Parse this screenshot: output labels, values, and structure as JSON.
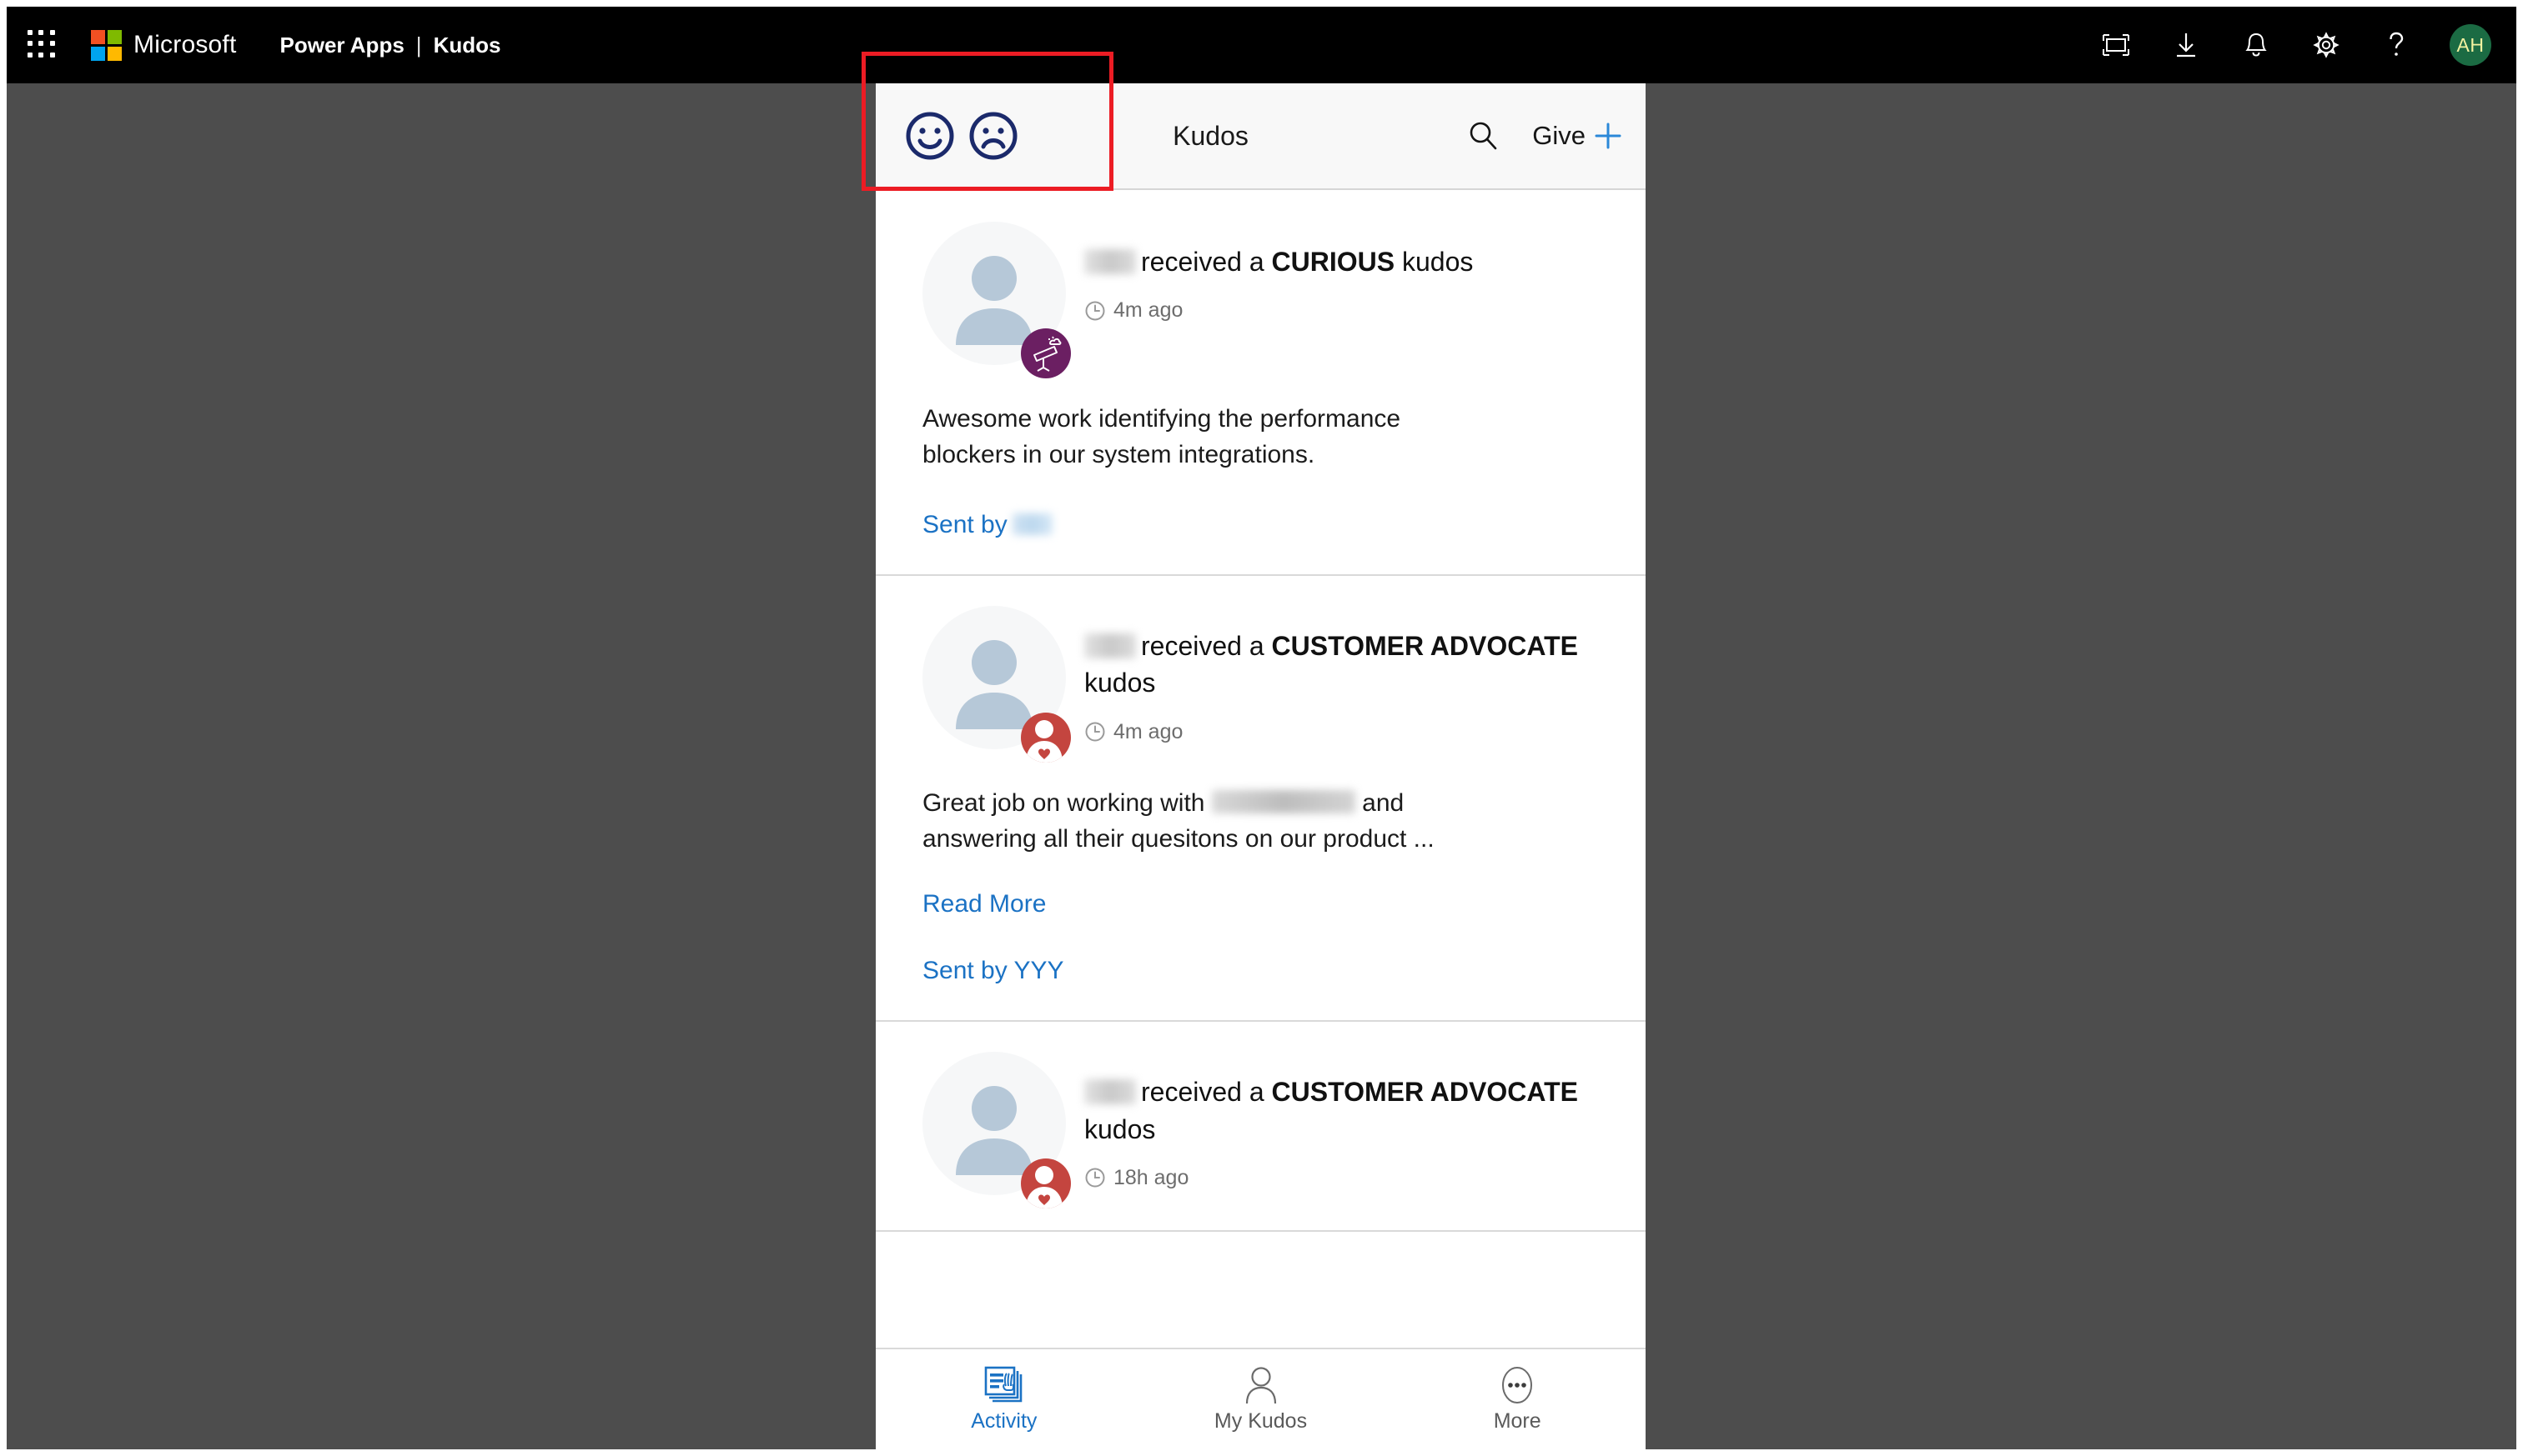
{
  "suite_bar": {
    "waffle_icon": "app-launcher-icon",
    "brand": "Microsoft",
    "app_name": "Power Apps",
    "separator": "|",
    "sub_app": "Kudos",
    "icons": [
      {
        "name": "fullscreen-icon",
        "label": "Full screen"
      },
      {
        "name": "download-icon",
        "label": "Download"
      },
      {
        "name": "bell-icon",
        "label": "Notifications"
      },
      {
        "name": "gear-icon",
        "label": "Settings"
      },
      {
        "name": "help-icon",
        "label": "Help"
      }
    ],
    "avatar": {
      "initials": "AH",
      "color": "#1b6b43"
    }
  },
  "app": {
    "toolbar": {
      "happy_face_icon": "happy-face-icon",
      "sad_face_icon": "sad-face-icon",
      "title": "Kudos",
      "search_icon": "search-icon",
      "give_label": "Give",
      "plus_icon": "plus-icon",
      "face_color": "#1b2a6b",
      "plus_color": "#2b88d8"
    },
    "feed": [
      {
        "recipient_blurred": true,
        "headline_pre": "received a ",
        "kudos_type": "CURIOUS",
        "headline_post": " kudos",
        "time_icon": "clock-icon",
        "time": "4m ago",
        "badge_icon": "telescope-icon",
        "badge_color": "#6b1f62",
        "message": "Awesome work identifying the performance blockers in our system integrations.",
        "read_more": null,
        "sent_by_label": "Sent by",
        "sent_by_name": "",
        "sent_by_blurred": true
      },
      {
        "recipient_blurred": true,
        "headline_pre": "received a ",
        "kudos_type": "CUSTOMER ADVOCATE",
        "headline_post": " kudos",
        "time_icon": "clock-icon",
        "time": "4m ago",
        "badge_icon": "customer-advocate-icon",
        "badge_color": "#c4453f",
        "message_part1": "Great job on working with ",
        "message_blurred": true,
        "message_part2": " and answering all their quesitons on our product ...",
        "read_more": "Read More",
        "sent_by_label": "Sent by YYY",
        "sent_by_name": "YYY",
        "sent_by_blurred": false
      },
      {
        "recipient_blurred": true,
        "headline_pre": "received a ",
        "kudos_type": "CUSTOMER ADVOCATE",
        "headline_post": " kudos",
        "time_icon": "clock-icon",
        "time": "18h ago",
        "badge_icon": "customer-advocate-icon",
        "badge_color": "#c4453f",
        "message": "",
        "read_more": null,
        "sent_by_label": "",
        "sent_by_name": "",
        "sent_by_blurred": false
      }
    ],
    "bottom_nav": [
      {
        "icon": "activity-feed-icon",
        "label": "Activity",
        "active": true
      },
      {
        "icon": "person-icon",
        "label": "My Kudos",
        "active": false
      },
      {
        "icon": "more-ellipsis-icon",
        "label": "More",
        "active": false
      }
    ]
  },
  "annotation": {
    "highlight_color": "#ec1c24",
    "target": "feedback-face-buttons"
  }
}
